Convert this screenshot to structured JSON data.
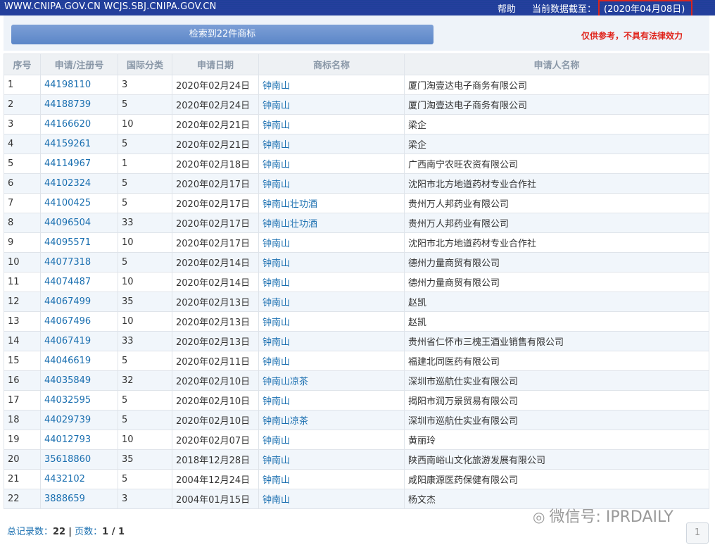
{
  "topbar": {
    "sites": "WWW.CNIPA.GOV.CN WCJS.SBJ.CNIPA.GOV.CN",
    "help": "帮助",
    "asof_label": "当前数据截至：",
    "asof_value": "(2020年04月08日)"
  },
  "search": {
    "result_label": "检索到22件商标"
  },
  "disclaimer": "仅供参考，不具有法律效力",
  "table": {
    "headers": [
      "序号",
      "申请/注册号",
      "国际分类",
      "申请日期",
      "商标名称",
      "申请人名称"
    ],
    "rows": [
      [
        "1",
        "44198110",
        "3",
        "2020年02月24日",
        "钟南山",
        "厦门淘壹达电子商务有限公司"
      ],
      [
        "2",
        "44188739",
        "5",
        "2020年02月24日",
        "钟南山",
        "厦门淘壹达电子商务有限公司"
      ],
      [
        "3",
        "44166620",
        "10",
        "2020年02月21日",
        "钟南山",
        "梁企"
      ],
      [
        "4",
        "44159261",
        "5",
        "2020年02月21日",
        "钟南山",
        "梁企"
      ],
      [
        "5",
        "44114967",
        "1",
        "2020年02月18日",
        "钟南山",
        "广西南宁农旺农资有限公司"
      ],
      [
        "6",
        "44102324",
        "5",
        "2020年02月17日",
        "钟南山",
        "沈阳市北方地道药材专业合作社"
      ],
      [
        "7",
        "44100425",
        "5",
        "2020年02月17日",
        "钟南山壮功酒",
        "贵州万人邦药业有限公司"
      ],
      [
        "8",
        "44096504",
        "33",
        "2020年02月17日",
        "钟南山壮功酒",
        "贵州万人邦药业有限公司"
      ],
      [
        "9",
        "44095571",
        "10",
        "2020年02月17日",
        "钟南山",
        "沈阳市北方地道药材专业合作社"
      ],
      [
        "10",
        "44077318",
        "5",
        "2020年02月14日",
        "钟南山",
        "德州力量商贸有限公司"
      ],
      [
        "11",
        "44074487",
        "10",
        "2020年02月14日",
        "钟南山",
        "德州力量商贸有限公司"
      ],
      [
        "12",
        "44067499",
        "35",
        "2020年02月13日",
        "钟南山",
        "赵凯"
      ],
      [
        "13",
        "44067496",
        "10",
        "2020年02月13日",
        "钟南山",
        "赵凯"
      ],
      [
        "14",
        "44067419",
        "33",
        "2020年02月13日",
        "钟南山",
        "贵州省仁怀市三槐王酒业销售有限公司"
      ],
      [
        "15",
        "44046619",
        "5",
        "2020年02月11日",
        "钟南山",
        "福建北同医药有限公司"
      ],
      [
        "16",
        "44035849",
        "32",
        "2020年02月10日",
        "钟南山凉茶",
        "深圳市巡航仕实业有限公司"
      ],
      [
        "17",
        "44032595",
        "5",
        "2020年02月10日",
        "钟南山",
        "揭阳市润万景贸易有限公司"
      ],
      [
        "18",
        "44029739",
        "5",
        "2020年02月10日",
        "钟南山凉茶",
        "深圳市巡航仕实业有限公司"
      ],
      [
        "19",
        "44012793",
        "10",
        "2020年02月07日",
        "钟南山",
        "黄丽玲"
      ],
      [
        "20",
        "35618860",
        "35",
        "2018年12月28日",
        "钟南山",
        "陕西南峪山文化旅游发展有限公司"
      ],
      [
        "21",
        "4432102",
        "5",
        "2004年12月24日",
        "钟南山",
        "咸阳康源医药保健有限公司"
      ],
      [
        "22",
        "3888659",
        "3",
        "2004年01月15日",
        "钟南山",
        "杨文杰"
      ]
    ]
  },
  "footer": {
    "total_label": "总记录数：",
    "total_value": "22",
    "sep": "|",
    "pages_label": "页数：",
    "pages_value": "1 / 1"
  },
  "pagination": {
    "current": "1"
  },
  "watermark": {
    "icon": "wechat-icon",
    "text": "微信号: IPRDAILY"
  },
  "colors": {
    "topbar": "#243f9d",
    "link": "#1a6fb0",
    "alert": "#e0231b",
    "stripe": "#f1f6fb"
  }
}
